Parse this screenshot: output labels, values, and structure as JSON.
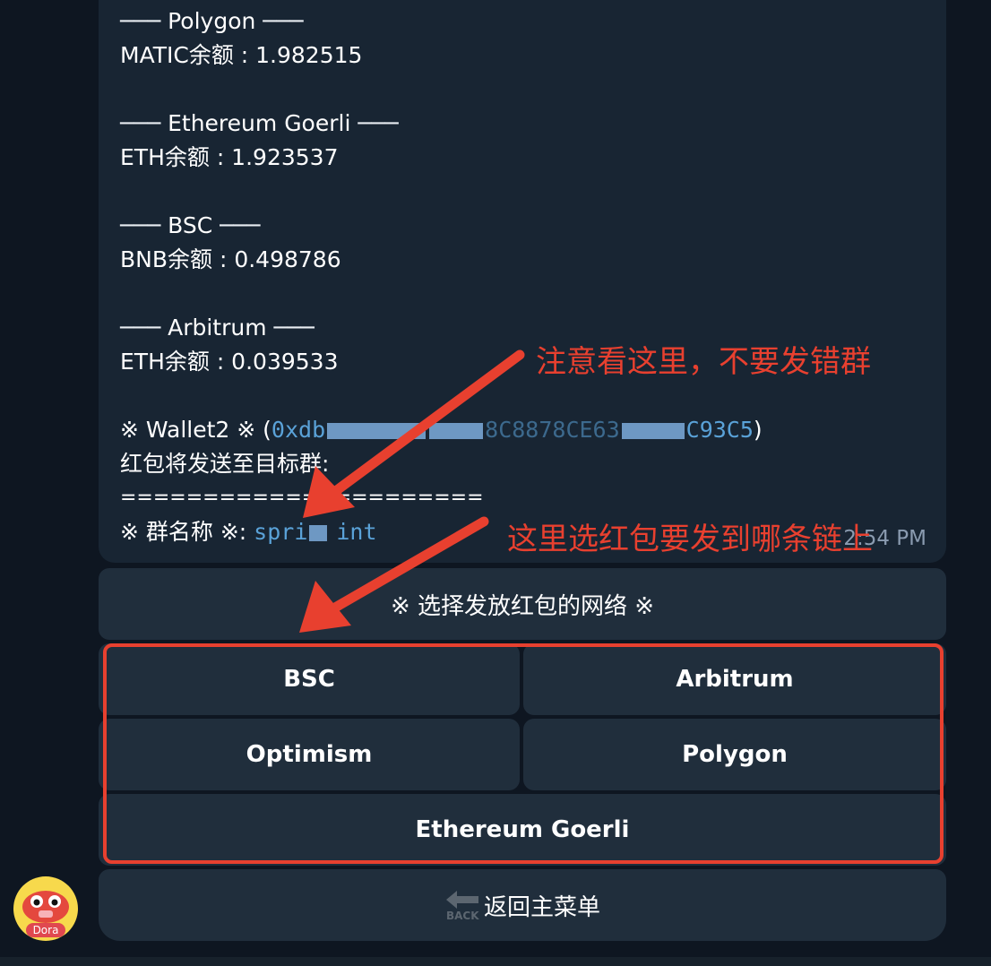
{
  "message": {
    "lines": [
      {
        "sep": "─── ",
        "name": "Polygon",
        "sep_end": " ───"
      },
      {
        "balance": "MATIC余额 : 1.982515"
      },
      {
        "sep": "─── ",
        "name": "Ethereum Goerli",
        "sep_end": " ───"
      },
      {
        "balance": "ETH余额 : 1.923537"
      },
      {
        "sep": "─── ",
        "name": "BSC",
        "sep_end": " ───"
      },
      {
        "balance": "BNB余额 : 0.498786"
      },
      {
        "sep": "─── ",
        "name": "Arbitrum",
        "sep_end": " ───"
      },
      {
        "balance": "ETH余额 : 0.039533"
      }
    ],
    "wallet_prefix": "※ Wallet2 ※ (",
    "wallet_addr_start": "0xdb",
    "wallet_addr_mid": "8C8878CE63",
    "wallet_addr_end": "C93C5",
    "wallet_suffix": ")",
    "target_line": "红包将发送至目标群:",
    "divider": "======================",
    "group_label": "※ 群名称 ※:",
    "group_name_start": "spri",
    "group_name_end": "int",
    "time": "2:54 PM"
  },
  "keyboard": {
    "header": "※ 选择发放红包的网络 ※",
    "buttons": {
      "bsc": "BSC",
      "arbitrum": "Arbitrum",
      "optimism": "Optimism",
      "polygon": "Polygon",
      "goerli": "Ethereum Goerli"
    },
    "back_label": "返回主菜单",
    "back_icon_text": "BACK"
  },
  "annotations": {
    "note1": "注意看这里，不要发错群",
    "note2": "这里选红包要发到哪条链上",
    "color": "#e8402f"
  },
  "avatar": {
    "tag": "Dora"
  }
}
